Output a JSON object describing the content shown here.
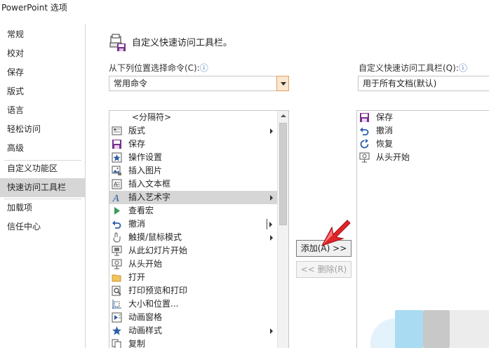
{
  "window": {
    "title": "PowerPoint 选项"
  },
  "nav": {
    "items": [
      {
        "label": "常规",
        "selected": false
      },
      {
        "label": "校对",
        "selected": false
      },
      {
        "label": "保存",
        "selected": false
      },
      {
        "label": "版式",
        "selected": false
      },
      {
        "label": "语言",
        "selected": false
      },
      {
        "label": "轻松访问",
        "selected": false
      },
      {
        "label": "高级",
        "selected": false
      },
      {
        "label": "自定义功能区",
        "selected": false
      },
      {
        "label": "快速访问工具栏",
        "selected": true
      },
      {
        "label": "加载项",
        "selected": false
      },
      {
        "label": "信任中心",
        "selected": false
      }
    ]
  },
  "main": {
    "heading": "自定义快速访问工具栏。",
    "choose_label": "从下列位置选择命令(C):",
    "choose_value": "常用命令",
    "customize_label": "自定义快速访问工具栏(Q):",
    "customize_value": "用于所有文档(默认)",
    "info_glyph": "ⓘ",
    "commands": [
      {
        "label": "<分隔符>",
        "icon": "separator",
        "submenu": false
      },
      {
        "label": "版式",
        "icon": "layout-icon",
        "submenu": true
      },
      {
        "label": "保存",
        "icon": "save-icon",
        "submenu": false
      },
      {
        "label": "操作设置",
        "icon": "action-settings-icon",
        "submenu": false
      },
      {
        "label": "插入图片",
        "icon": "insert-picture-icon",
        "submenu": false
      },
      {
        "label": "插入文本框",
        "icon": "insert-textbox-icon",
        "submenu": false
      },
      {
        "label": "插入艺术字",
        "icon": "wordart-icon",
        "submenu": true
      },
      {
        "label": "查看宏",
        "icon": "macro-play-icon",
        "submenu": false
      },
      {
        "label": "撤消",
        "icon": "undo-icon",
        "submenu": false
      },
      {
        "label": "触摸/鼠标模式",
        "icon": "touch-mode-icon",
        "submenu": true
      },
      {
        "label": "从此幻灯片开始",
        "icon": "from-current-slide-icon",
        "submenu": false
      },
      {
        "label": "从头开始",
        "icon": "from-beginning-icon",
        "submenu": false
      },
      {
        "label": "打开",
        "icon": "open-folder-icon",
        "submenu": false
      },
      {
        "label": "打印预览和打印",
        "icon": "print-preview-icon",
        "submenu": false
      },
      {
        "label": "大小和位置...",
        "icon": "size-position-icon",
        "submenu": false
      },
      {
        "label": "动画窗格",
        "icon": "animation-pane-icon",
        "submenu": false
      },
      {
        "label": "动画样式",
        "icon": "animation-styles-icon",
        "submenu": true
      },
      {
        "label": "复制",
        "icon": "copy-icon",
        "submenu": false
      }
    ],
    "highlighted_command": "插入艺术字",
    "toolbar_items": [
      {
        "label": "保存",
        "icon": "save-icon"
      },
      {
        "label": "撤消",
        "icon": "undo-icon"
      },
      {
        "label": "恢复",
        "icon": "redo-icon"
      },
      {
        "label": "从头开始",
        "icon": "from-beginning-icon"
      }
    ],
    "add_button": "添加(A) >>",
    "remove_button": "<< 删除(R)"
  },
  "colors": {
    "nav_selected": "#d6d6d6",
    "row_highlight": "#d6d6d6",
    "save_purple": "#7b2f8e",
    "action_blue": "#2b5fa8",
    "macro_green": "#3a9a5a",
    "cursor_red": "#e0242a",
    "dropdown_accent": "#fbe6cf"
  }
}
